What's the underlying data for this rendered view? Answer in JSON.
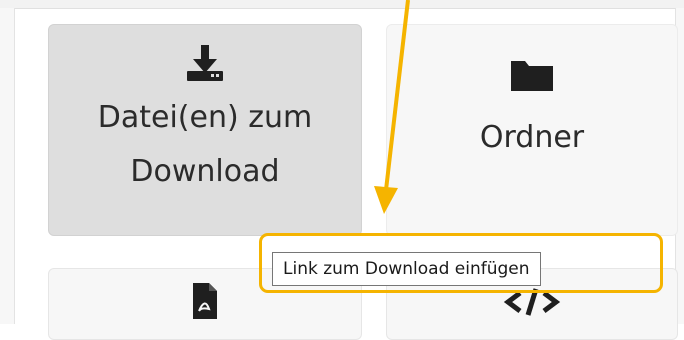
{
  "tiles": {
    "download": {
      "label_line1": "Datei(en) zum",
      "label_line2": "Download",
      "icon": "download-icon"
    },
    "folder": {
      "label": "Ordner",
      "icon": "folder-icon"
    },
    "pdf": {
      "icon": "pdf-file-icon"
    },
    "code": {
      "icon": "code-icon"
    }
  },
  "tooltip": {
    "text": "Link zum Download einfügen"
  },
  "annotation": {
    "color": "#f5b400"
  },
  "colors": {
    "tile_selected": "#dedede",
    "tile_default": "#f7f7f7",
    "text": "#2b2b2b"
  }
}
